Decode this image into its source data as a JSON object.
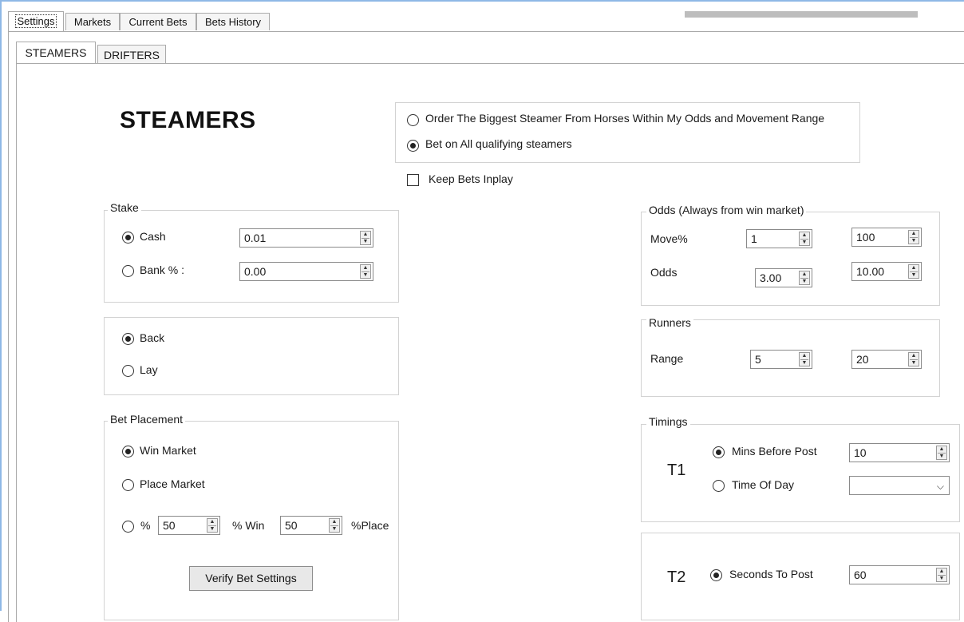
{
  "top_tabs": [
    "Settings",
    "Markets",
    "Current Bets",
    "Bets History"
  ],
  "sub_tabs": [
    "STEAMERS",
    "DRIFTERS"
  ],
  "title": "STEAMERS",
  "mode_options": [
    {
      "label": "Order The Biggest Steamer From Horses Within My Odds and Movement Range",
      "selected": false
    },
    {
      "label": "Bet on All qualifying steamers",
      "selected": true
    }
  ],
  "keep_inplay": {
    "label": "Keep Bets Inplay",
    "checked": false
  },
  "stake": {
    "title": "Stake",
    "cash": {
      "label": "Cash",
      "value": "0.01",
      "selected": true
    },
    "bank": {
      "label": "Bank % :",
      "value": "0.00",
      "selected": false
    }
  },
  "bet_type": {
    "back": {
      "label": "Back",
      "selected": true
    },
    "lay": {
      "label": "Lay",
      "selected": false
    }
  },
  "bet_placement": {
    "title": "Bet Placement",
    "win": {
      "label": "Win Market",
      "selected": true
    },
    "place": {
      "label": "Place Market",
      "selected": false
    },
    "split": {
      "label": "%",
      "win_value": "50",
      "win_label": "% Win",
      "place_value": "50",
      "place_label": "%Place",
      "selected": false
    },
    "verify_button": "Verify Bet Settings"
  },
  "odds": {
    "title": "Odds (Always from win market)",
    "move_label": "Move%",
    "move_min": "1",
    "move_max": "100",
    "odds_label": "Odds",
    "odds_min": "3.00",
    "odds_max": "10.00"
  },
  "runners": {
    "title": "Runners",
    "range_label": "Range",
    "min": "5",
    "max": "20"
  },
  "timings": {
    "title": "Timings",
    "t1": "T1",
    "mins_before_post": {
      "label": "Mins Before Post",
      "value": "10",
      "selected": true
    },
    "time_of_day": {
      "label": "Time Of Day",
      "value": "",
      "selected": false
    },
    "t2": "T2",
    "seconds_to_post": {
      "label": "Seconds To Post",
      "value": "60",
      "selected": true
    }
  }
}
